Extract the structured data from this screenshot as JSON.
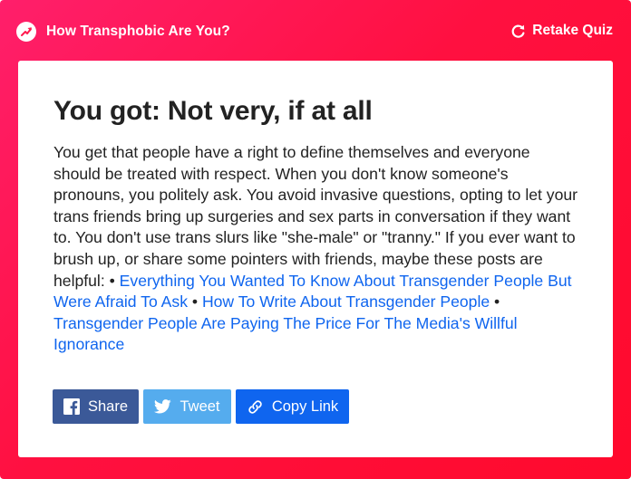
{
  "header": {
    "quiz_title": "How Transphobic Are You?",
    "retake_label": "Retake Quiz"
  },
  "result": {
    "title": "You got: Not very, if at all",
    "description": "You get that people have a right to define themselves and everyone should be treated with respect. When you don't know someone's pronouns, you politely ask. You avoid invasive questions, opting to let your trans friends bring up surgeries and sex parts in conversation if they want to. You don't use trans slurs like \"she-male\" or \"tranny.\" If you ever want to brush up, or share some pointers with friends, maybe these posts are helpful:",
    "bullet": " • ",
    "links": [
      "Everything You Wanted To Know About Transgender People But Were Afraid To Ask",
      "How To Write About Transgender People",
      "Transgender People Are Paying The Price For The Media's Willful Ignorance"
    ]
  },
  "share": {
    "facebook_label": "Share",
    "twitter_label": "Tweet",
    "copy_label": "Copy Link"
  },
  "colors": {
    "gradient_start": "#ff1f6b",
    "gradient_end": "#ff0a2c",
    "link": "#0f65ef",
    "facebook": "#3b5998",
    "twitter": "#55acee",
    "copy_link": "#0f65ef",
    "text": "#222222"
  },
  "icons": {
    "quiz": "trending-arrow-icon",
    "retake": "refresh-icon",
    "facebook": "facebook-icon",
    "twitter": "twitter-bird-icon",
    "copy": "chain-link-icon"
  }
}
